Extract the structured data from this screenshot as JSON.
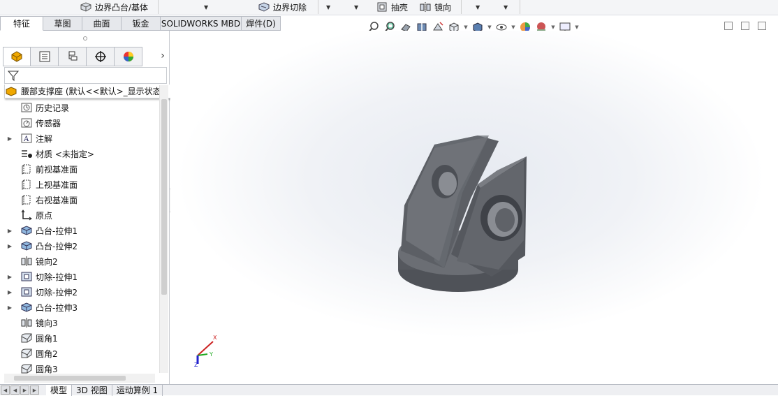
{
  "toolbar": {
    "boundary_boss": "边界凸台/基体",
    "boundary_cut": "边界切除",
    "shell": "抽壳",
    "mirror": "镜向"
  },
  "tabs": [
    {
      "label": "特征",
      "active": true
    },
    {
      "label": "草图"
    },
    {
      "label": "曲面"
    },
    {
      "label": "钣金"
    },
    {
      "label": "SOLIDWORKS MBD"
    },
    {
      "label": "焊件(D)"
    }
  ],
  "feature_tree": {
    "root": "腰部支撑座 (默认<<默认>_显示状态",
    "items": [
      {
        "label": "历史记录",
        "icon": "history-icon",
        "expandable": false
      },
      {
        "label": "传感器",
        "icon": "sensor-icon",
        "expandable": false
      },
      {
        "label": "注解",
        "icon": "annotation-icon",
        "expandable": true
      },
      {
        "label": "材质 <未指定>",
        "icon": "material-icon",
        "expandable": false
      },
      {
        "label": "前视基准面",
        "icon": "plane-icon",
        "expandable": false
      },
      {
        "label": "上视基准面",
        "icon": "plane-icon",
        "expandable": false
      },
      {
        "label": "右视基准面",
        "icon": "plane-icon",
        "expandable": false
      },
      {
        "label": "原点",
        "icon": "origin-icon",
        "expandable": false
      },
      {
        "label": "凸台-拉伸1",
        "icon": "extrude-boss-icon",
        "expandable": true
      },
      {
        "label": "凸台-拉伸2",
        "icon": "extrude-boss-icon",
        "expandable": true
      },
      {
        "label": "镜向2",
        "icon": "mirror-icon",
        "expandable": false
      },
      {
        "label": "切除-拉伸1",
        "icon": "extrude-cut-icon",
        "expandable": true
      },
      {
        "label": "切除-拉伸2",
        "icon": "extrude-cut-icon",
        "expandable": true
      },
      {
        "label": "凸台-拉伸3",
        "icon": "extrude-boss-icon",
        "expandable": true
      },
      {
        "label": "镜向3",
        "icon": "mirror-icon",
        "expandable": false
      },
      {
        "label": "圆角1",
        "icon": "fillet-icon",
        "expandable": false
      },
      {
        "label": "圆角2",
        "icon": "fillet-icon",
        "expandable": false
      },
      {
        "label": "圆角3",
        "icon": "fillet-icon",
        "expandable": false
      }
    ]
  },
  "triad": {
    "x": "X",
    "y": "Y",
    "z": "Z"
  },
  "bottom_tabs": [
    {
      "label": "模型",
      "active": true
    },
    {
      "label": "3D 视图"
    },
    {
      "label": "运动算例 1"
    }
  ],
  "colors": {
    "part": "#5a5d63",
    "accent": "#f0a800"
  }
}
